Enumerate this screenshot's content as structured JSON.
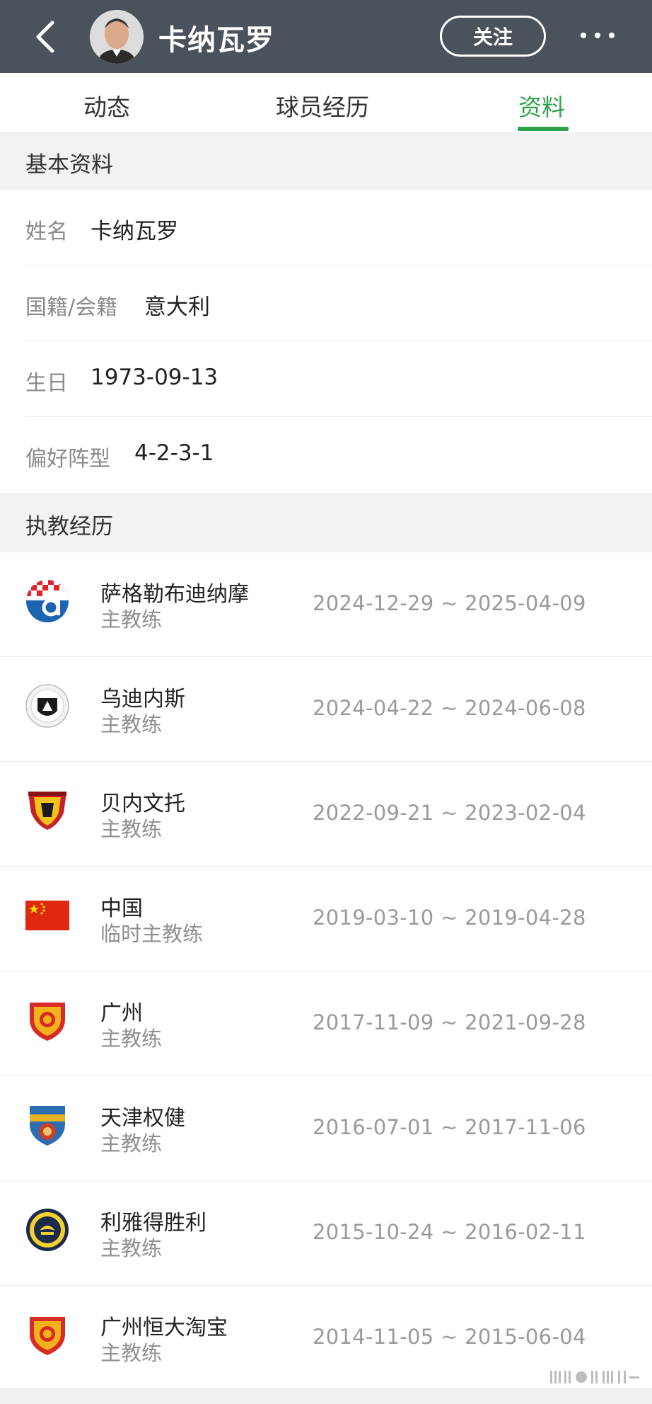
{
  "header": {
    "title": "卡纳瓦罗",
    "follow_label": "关注",
    "back_icon": "chevron-left-icon",
    "more_icon": "more-horizontal-icon",
    "bg_color": "#4a525b"
  },
  "tabs": [
    {
      "label": "动态",
      "active": false
    },
    {
      "label": "球员经历",
      "active": false
    },
    {
      "label": "资料",
      "active": true
    }
  ],
  "accent_color": "#2ea24a",
  "basic_info": {
    "section_title": "基本资料",
    "fields": [
      {
        "label": "姓名",
        "value": "卡纳瓦罗"
      },
      {
        "label": "国籍/会籍",
        "value": "意大利"
      },
      {
        "label": "生日",
        "value": "1973-09-13"
      },
      {
        "label": "偏好阵型",
        "value": "4-2-3-1"
      }
    ]
  },
  "coaching": {
    "section_title": "执教经历",
    "entries": [
      {
        "team": "萨格勒布迪纳摩",
        "role": "主教练",
        "dates": "2024-12-29 ~ 2025-04-09",
        "logo": "dinamo-zagreb-logo"
      },
      {
        "team": "乌迪内斯",
        "role": "主教练",
        "dates": "2024-04-22 ~ 2024-06-08",
        "logo": "udinese-logo"
      },
      {
        "team": "贝内文托",
        "role": "主教练",
        "dates": "2022-09-21 ~ 2023-02-04",
        "logo": "benevento-logo"
      },
      {
        "team": "中国",
        "role": "临时主教练",
        "dates": "2019-03-10 ~ 2019-04-28",
        "logo": "china-flag"
      },
      {
        "team": "广州",
        "role": "主教练",
        "dates": "2017-11-09 ~ 2021-09-28",
        "logo": "guangzhou-logo"
      },
      {
        "team": "天津权健",
        "role": "主教练",
        "dates": "2016-07-01 ~ 2017-11-06",
        "logo": "tianjin-quanjian-logo"
      },
      {
        "team": "利雅得胜利",
        "role": "主教练",
        "dates": "2015-10-24 ~ 2016-02-11",
        "logo": "al-nassr-logo"
      },
      {
        "team": "广州恒大淘宝",
        "role": "主教练",
        "dates": "2014-11-05 ~ 2015-06-04",
        "logo": "guangzhou-evergrande-logo"
      }
    ]
  }
}
